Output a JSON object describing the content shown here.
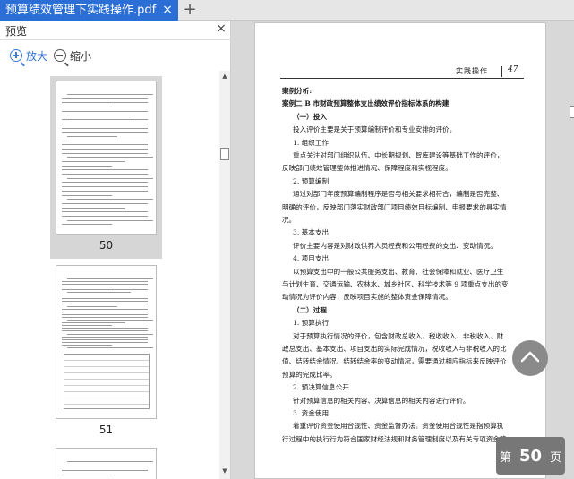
{
  "tab": {
    "title": "预算绩效管理下实践操作.pdf",
    "close": "×",
    "new_tab": "+"
  },
  "sidebar": {
    "title": "预览",
    "close": "×",
    "zoom_in": "放大",
    "zoom_out": "缩小",
    "thumbnails": [
      {
        "page": "50",
        "selected": true
      },
      {
        "page": "51",
        "selected": false
      },
      {
        "page": "",
        "selected": false
      }
    ]
  },
  "page": {
    "running_title": "实践操作",
    "page_number": "47",
    "lines": [
      {
        "text": "案例分析:",
        "bold": true,
        "indent": 0
      },
      {
        "text": "案例二  B 市财政预算整体支出绩效评价指标体系的构建",
        "bold": true,
        "indent": 0
      },
      {
        "text": "（一）投入",
        "bold": true,
        "indent": 1
      },
      {
        "text": "投入评价主要是关于预算编制评价和专业安排的评价。",
        "bold": false,
        "indent": 1
      },
      {
        "text": "1. 组织工作",
        "bold": false,
        "indent": 1
      },
      {
        "text": "重点关注对部门组织队伍、中长期规划、智库建设等基础工作的评价，",
        "bold": false,
        "indent": 1
      },
      {
        "text": "反映部门绩效管理整体推进情况、保障程度和实视程度。",
        "bold": false,
        "indent": 0
      },
      {
        "text": "2. 预算编制",
        "bold": false,
        "indent": 1
      },
      {
        "text": "通过对部门年度预算编制程序是否与相关要求相符合，编制是否完整、",
        "bold": false,
        "indent": 1
      },
      {
        "text": "明确的评价，反映部门落实财政部门项目绩效目标编制、申报要求的具实情",
        "bold": false,
        "indent": 0
      },
      {
        "text": "况。",
        "bold": false,
        "indent": 0
      },
      {
        "text": "3. 基本支出",
        "bold": false,
        "indent": 1
      },
      {
        "text": "评价主要内容是对财政供养人员经费和公用经费的支出、变动情况。",
        "bold": false,
        "indent": 1
      },
      {
        "text": "4. 项目支出",
        "bold": false,
        "indent": 1
      },
      {
        "text": "以预算支出中的一般公共服务支出、教育、社会保障和就业、医疗卫生",
        "bold": false,
        "indent": 1
      },
      {
        "text": "与计划生育、交通运输、农林水、城乡社区、科学技术等 9 项重点支出的变",
        "bold": false,
        "indent": 0
      },
      {
        "text": "动情况为评价内容，反映项目实施的整体资金保障情况。",
        "bold": false,
        "indent": 0
      },
      {
        "text": "（二）过程",
        "bold": true,
        "indent": 1
      },
      {
        "text": "1. 预算执行",
        "bold": false,
        "indent": 1
      },
      {
        "text": "对于预算执行情况的评价，包含财政总收入、税收收入、非税收入、财",
        "bold": false,
        "indent": 1
      },
      {
        "text": "政总支出、基本支出、项目支出的实际完成情况，税收收入与非税收入的比",
        "bold": false,
        "indent": 0
      },
      {
        "text": "值、结转结余情况、结转结余率的变动情况，需要通过相应指标来反映评价",
        "bold": false,
        "indent": 0
      },
      {
        "text": "预算的完成比率。",
        "bold": false,
        "indent": 0
      },
      {
        "text": "2. 预决算信息公开",
        "bold": false,
        "indent": 1
      },
      {
        "text": "针对预算信息的相关内容、决算信息的相关内容进行评价。",
        "bold": false,
        "indent": 1
      },
      {
        "text": "3. 资金使用",
        "bold": false,
        "indent": 1
      },
      {
        "text": "着重评价资金使用合规性、资金监督办法。资金使用合规性是指预算执",
        "bold": false,
        "indent": 1
      },
      {
        "text": "行过程中的执行行为符合国家财经法规和财务管理制度以及有关专项资金管",
        "bold": false,
        "indent": 0
      }
    ]
  },
  "page_indicator": {
    "prefix": "第",
    "number": "50",
    "suffix": "页"
  }
}
